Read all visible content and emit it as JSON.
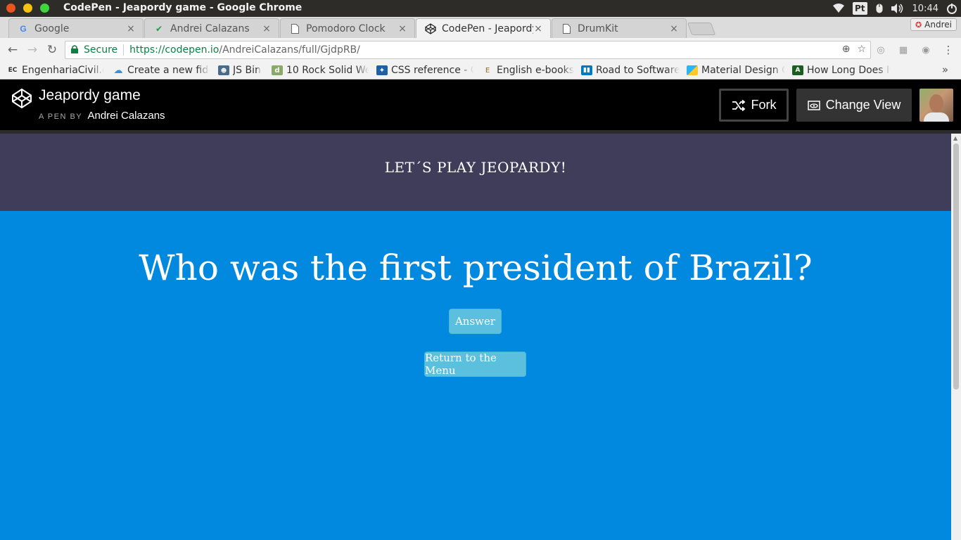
{
  "os": {
    "window_title": "CodePen - Jeapordy game - Google Chrome",
    "input_method": "Pt",
    "clock": "10:44"
  },
  "browser": {
    "tabs": [
      {
        "label": "Google",
        "icon": "google-icon"
      },
      {
        "label": "Andrei Calazans",
        "icon": "check-icon"
      },
      {
        "label": "Pomodoro Clock",
        "icon": "page-icon"
      },
      {
        "label": "CodePen - Jeapordy",
        "icon": "codepen-icon"
      },
      {
        "label": "DrumKit",
        "icon": "page-icon"
      }
    ],
    "active_tab_index": 3,
    "profile_name": "Andrei",
    "security_label": "Secure",
    "url_host": "https://codepen.io",
    "url_path": "/AndreiCalazans/full/GjdpRB/",
    "bookmarks": [
      {
        "label": "EngenhariaCivil.c",
        "icon": "ec-icon"
      },
      {
        "label": "Create a new fiddle",
        "icon": "cloud-icon"
      },
      {
        "label": "JS Bin",
        "icon": "jsbin-icon"
      },
      {
        "label": "10 Rock Solid Web",
        "icon": "d-icon"
      },
      {
        "label": "CSS reference - CS",
        "icon": "mdn-icon"
      },
      {
        "label": "English e-books",
        "icon": "book-icon"
      },
      {
        "label": "Road to Software",
        "icon": "trello-icon"
      },
      {
        "label": "Material Design C",
        "icon": "material-icon"
      },
      {
        "label": "How Long Does It",
        "icon": "a-icon"
      }
    ]
  },
  "codepen": {
    "pen_title": "Jeapordy game",
    "by_prefix": "A PEN BY",
    "author": "Andrei Calazans",
    "fork_label": "Fork",
    "change_view_label": "Change View"
  },
  "page": {
    "heading": "LET´S PLAY JEOPARDY!",
    "question": "Who was the first president of Brazil?",
    "answer_button": "Answer",
    "menu_button": "Return to the Menu"
  },
  "colors": {
    "header_bg": "#3f3d5a",
    "main_bg": "#0089df",
    "button_bg": "#5bc0de"
  }
}
